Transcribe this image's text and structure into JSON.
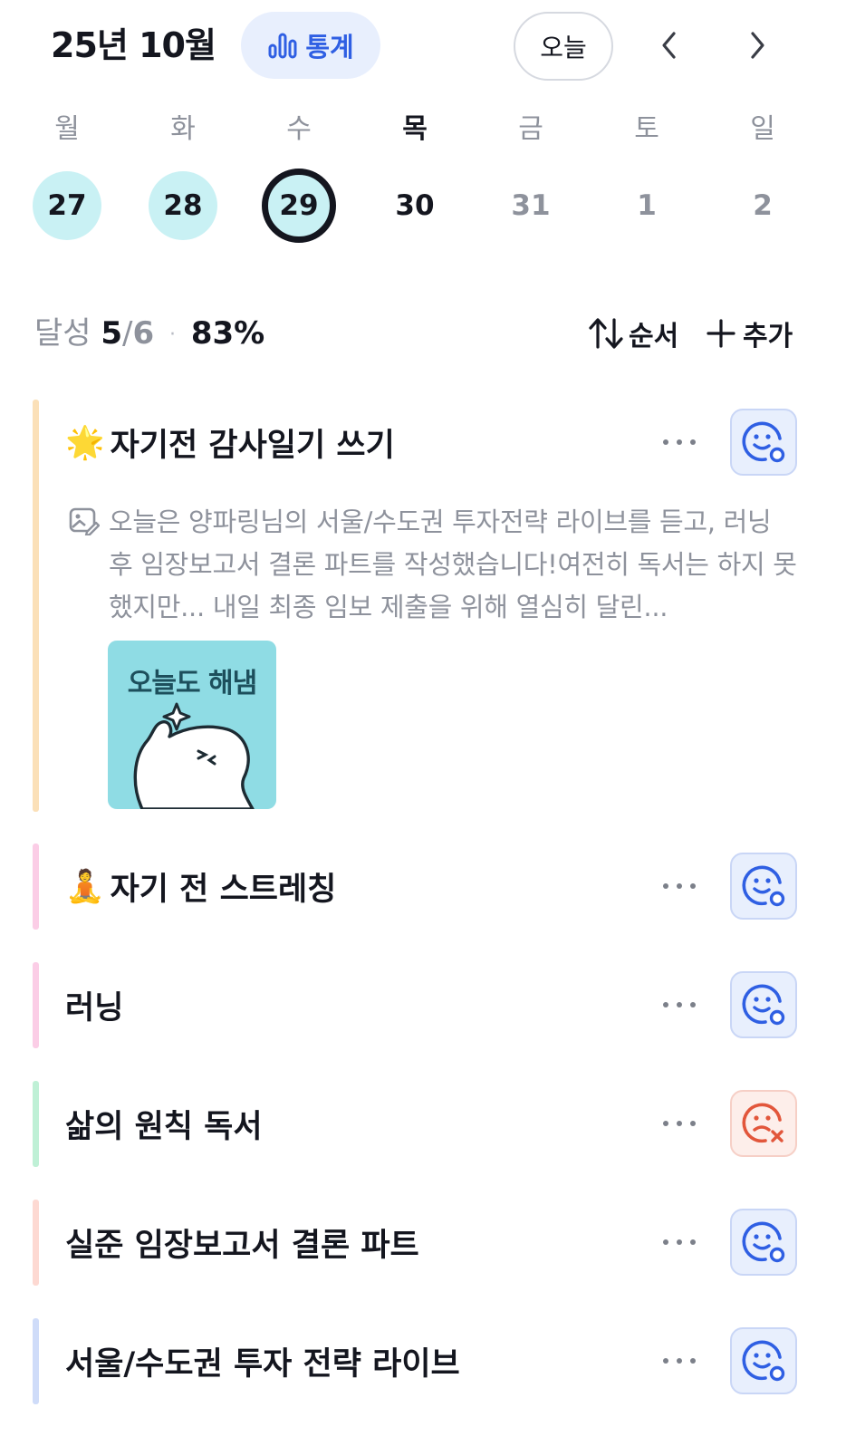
{
  "header": {
    "title": "25년 10월",
    "stats_label": "통계",
    "today_label": "오늘"
  },
  "week": {
    "days": [
      "월",
      "화",
      "수",
      "목",
      "금",
      "토",
      "일"
    ],
    "dates": [
      "27",
      "28",
      "29",
      "30",
      "31",
      "1",
      "2"
    ],
    "selected_index": 2,
    "completed_indices": [
      0,
      1,
      2
    ]
  },
  "summary": {
    "label": "달성",
    "done": "5",
    "slash": "/",
    "total": "6",
    "separator": "·",
    "percent": "83%",
    "order_label": "순서",
    "add_label": "추가"
  },
  "tasks": [
    {
      "emoji": "🌟",
      "title": "자기전 감사일기 쓰기",
      "bar_color": "#fbe0b8",
      "status": "done",
      "note": "오늘은 양파링님의 서울/수도권 투자전략 라이브를 듣고, 러닝 후 임장보고서 결론 파트를 작성했습니다!여전히 독서는 하지 못했지만... 내일 최종 임보 제출을 위해 열심히 달린...",
      "sticker_text": "오늘도 해냄"
    },
    {
      "emoji": "🧘",
      "title": "자기 전 스트레칭",
      "bar_color": "#fbcde6",
      "status": "done"
    },
    {
      "title": "러닝",
      "bar_color": "#fbcde6",
      "status": "done"
    },
    {
      "title": "삶의 원칙 독서",
      "bar_color": "#bff0d6",
      "status": "failed"
    },
    {
      "title": "실준 임장보고서 결론 파트",
      "bar_color": "#fdd9d2",
      "status": "done"
    },
    {
      "title": "서울/수도권 투자 전략 라이브",
      "bar_color": "#cfdcf9",
      "status": "done"
    }
  ],
  "colors": {
    "accent": "#2f5fe3",
    "done_circle": "#c9f1f4",
    "fail": "#e2563b",
    "muted_text": "#8e929c"
  },
  "icons": {
    "stats": "bar-chart-icon",
    "prev": "chevron-left-icon",
    "next": "chevron-right-icon",
    "order": "sort-arrows-icon",
    "add": "plus-icon",
    "more": "more-dots-icon",
    "done": "smile-check-icon",
    "failed": "sad-x-icon",
    "note": "note-image-icon"
  }
}
